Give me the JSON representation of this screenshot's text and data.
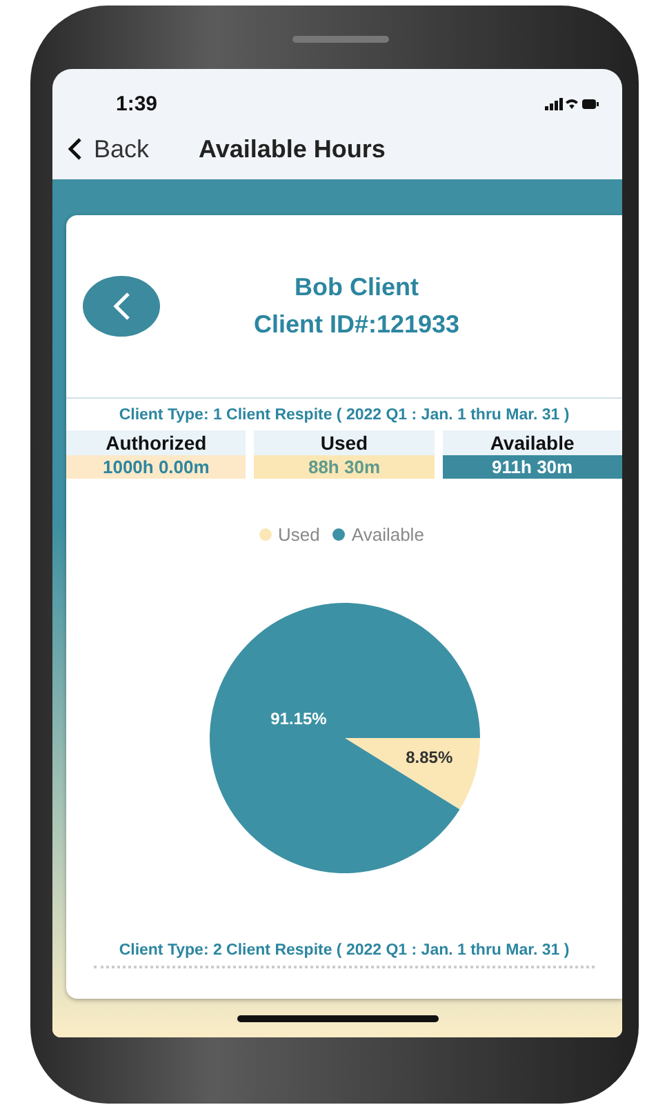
{
  "status_bar": {
    "time": "1:39"
  },
  "nav": {
    "back": "Back",
    "title": "Available Hours"
  },
  "client": {
    "name": "Bob Client",
    "id": "Client ID#:121933"
  },
  "sections": [
    {
      "client_type": "Client Type: 1 Client Respite ( 2022 Q1 : Jan. 1 thru Mar. 31 )",
      "columns": [
        {
          "kind": "authorized",
          "label": "Authorized",
          "value": "1000h 0.00m"
        },
        {
          "kind": "used",
          "label": "Used",
          "value": "88h 30m"
        },
        {
          "kind": "available",
          "label": "Available",
          "value": "911h 30m"
        }
      ],
      "legend": [
        {
          "color": "#fbe7b5"
        },
        {
          "color": "#3d91a4"
        }
      ],
      "chart_data": {
        "type": "pie",
        "categories": [
          "Used",
          "Available"
        ],
        "values": [
          8.85,
          91.15
        ],
        "value_labels": [
          "8.85%",
          "91.15%"
        ]
      }
    },
    {
      "client_type": "Client Type: 2 Client Respite ( 2022 Q1 : Jan. 1 thru Mar. 31 )"
    }
  ]
}
